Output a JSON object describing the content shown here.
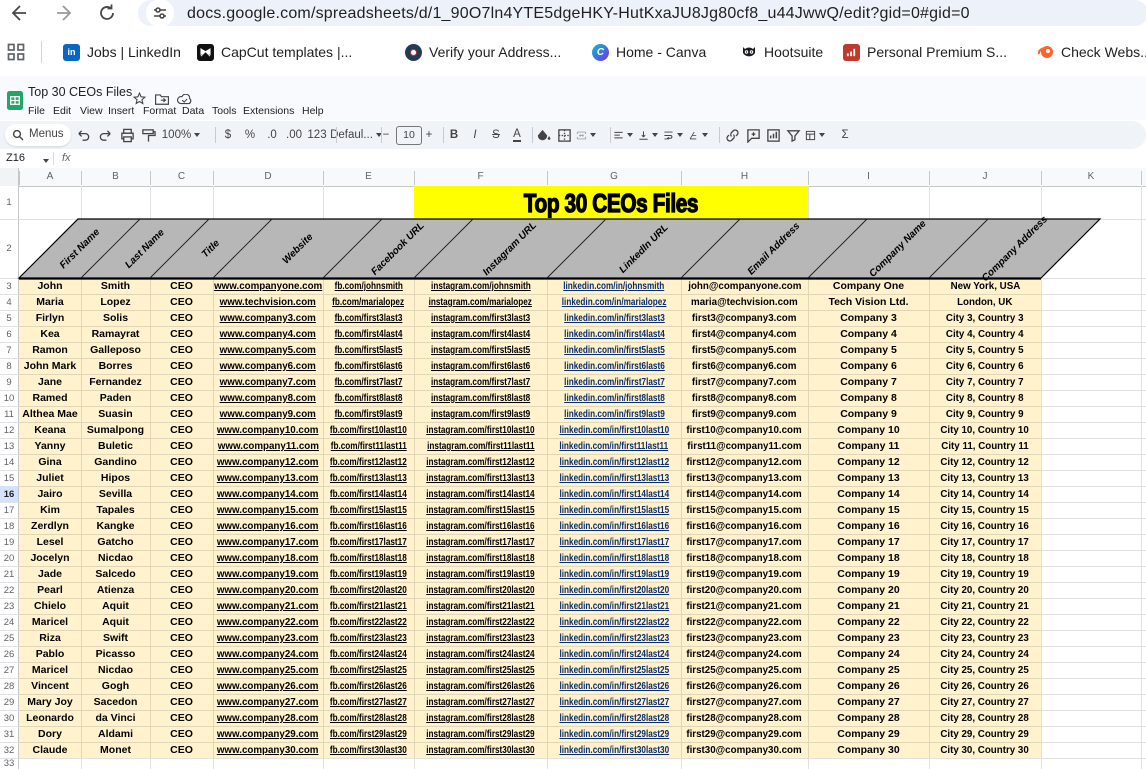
{
  "browser": {
    "url": "docs.google.com/spreadsheets/d/1_90O7ln4YTE5dgeHKY-HutKxaJU8Jg80cf8_u44JwwQ/edit?gid=0#gid=0",
    "bookmarks": [
      {
        "id": "linkedin",
        "label": "Jobs | LinkedIn"
      },
      {
        "id": "capcut",
        "label": "CapCut templates |..."
      },
      {
        "id": "verify",
        "label": "Verify your Address..."
      },
      {
        "id": "canva",
        "label": "Home - Canva"
      },
      {
        "id": "hootsuite",
        "label": "Hootsuite"
      },
      {
        "id": "premium",
        "label": "Personal Premium S..."
      },
      {
        "id": "checkwebs",
        "label": "Check Webs..."
      }
    ]
  },
  "appbar": {
    "title": "Top 30 CEOs Files",
    "menus": [
      "File",
      "Edit",
      "View",
      "Insert",
      "Format",
      "Data",
      "Tools",
      "Extensions",
      "Help"
    ]
  },
  "toolbar": {
    "menus_label": "Menus",
    "zoom": "100%",
    "currency": "$",
    "percent": "%",
    "decrease_decimals": ".0",
    "increase_decimals": ".00",
    "more_formats": "123",
    "font_name": "Defaul...",
    "font_size": "10",
    "bold": "B",
    "italic": "I",
    "strikethrough": "S",
    "text_color": "A",
    "functions": "Σ"
  },
  "formula_bar": {
    "name_box": "Z16",
    "fx": "fx"
  },
  "sheet": {
    "col_letters": [
      "A",
      "B",
      "C",
      "D",
      "E",
      "F",
      "G",
      "H",
      "I",
      "J",
      "K"
    ],
    "banner_title": "Top 30 CEOs Files",
    "headers": [
      "First Name",
      "Last Name",
      "Title",
      "Website",
      "Facebook URL",
      "Instagram URL",
      "LinkedIn URL",
      "Email Address",
      "Company Name",
      "Company Address"
    ],
    "selected_row": 16,
    "first_data_row": 3,
    "rows": [
      [
        "John",
        "Smith",
        "CEO",
        "www.companyone.com",
        "fb.com/johnsmith",
        "instagram.com/johnsmith",
        "linkedin.com/in/johnsmith",
        "john@companyone.com",
        "Company One",
        "New York, USA"
      ],
      [
        "Maria",
        "Lopez",
        "CEO",
        "www.techvision.com",
        "fb.com/marialopez",
        "instagram.com/marialopez",
        "linkedin.com/in/marialopez",
        "maria@techvision.com",
        "Tech Vision Ltd.",
        "London, UK"
      ],
      [
        "Firlyn",
        "Solis",
        "CEO",
        "www.company3.com",
        "fb.com/first3last3",
        "instagram.com/first3last3",
        "linkedin.com/in/first3last3",
        "first3@company3.com",
        "Company 3",
        "City 3, Country 3"
      ],
      [
        "Kea",
        "Ramayrat",
        "CEO",
        "www.company4.com",
        "fb.com/first4last4",
        "instagram.com/first4last4",
        "linkedin.com/in/first4last4",
        "first4@company4.com",
        "Company 4",
        "City 4, Country 4"
      ],
      [
        "Ramon",
        "Galleposo",
        "CEO",
        "www.company5.com",
        "fb.com/first5last5",
        "instagram.com/first5last5",
        "linkedin.com/in/first5last5",
        "first5@company5.com",
        "Company 5",
        "City 5, Country 5"
      ],
      [
        "John Mark",
        "Borres",
        "CEO",
        "www.company6.com",
        "fb.com/first6last6",
        "instagram.com/first6last6",
        "linkedin.com/in/first6last6",
        "first6@company6.com",
        "Company 6",
        "City 6, Country 6"
      ],
      [
        "Jane",
        "Fernandez",
        "CEO",
        "www.company7.com",
        "fb.com/first7last7",
        "instagram.com/first7last7",
        "linkedin.com/in/first7last7",
        "first7@company7.com",
        "Company 7",
        "City 7, Country 7"
      ],
      [
        "Ramed",
        "Paden",
        "CEO",
        "www.company8.com",
        "fb.com/first8last8",
        "instagram.com/first8last8",
        "linkedin.com/in/first8last8",
        "first8@company8.com",
        "Company 8",
        "City 8, Country 8"
      ],
      [
        "Althea Mae",
        "Suasin",
        "CEO",
        "www.company9.com",
        "fb.com/first9last9",
        "instagram.com/first9last9",
        "linkedin.com/in/first9last9",
        "first9@company9.com",
        "Company 9",
        "City 9, Country 9"
      ],
      [
        "Keana",
        "Sumalpong",
        "CEO",
        "www.company10.com",
        "fb.com/first10last10",
        "instagram.com/first10last10",
        "linkedin.com/in/first10last10",
        "first10@company10.com",
        "Company 10",
        "City 10, Country 10"
      ],
      [
        "Yanny",
        "Buletic",
        "CEO",
        "www.company11.com",
        "fb.com/first11last11",
        "instagram.com/first11last11",
        "linkedin.com/in/first11last11",
        "first11@company11.com",
        "Company 11",
        "City 11, Country 11"
      ],
      [
        "Gina",
        "Gandino",
        "CEO",
        "www.company12.com",
        "fb.com/first12last12",
        "instagram.com/first12last12",
        "linkedin.com/in/first12last12",
        "first12@company12.com",
        "Company 12",
        "City 12, Country 12"
      ],
      [
        "Juliet",
        "Hipos",
        "CEO",
        "www.company13.com",
        "fb.com/first13last13",
        "instagram.com/first13last13",
        "linkedin.com/in/first13last13",
        "first13@company13.com",
        "Company 13",
        "City 13, Country 13"
      ],
      [
        "Jairo",
        "Sevilla",
        "CEO",
        "www.company14.com",
        "fb.com/first14last14",
        "instagram.com/first14last14",
        "linkedin.com/in/first14last14",
        "first14@company14.com",
        "Company 14",
        "City 14, Country 14"
      ],
      [
        "Kim",
        "Tapales",
        "CEO",
        "www.company15.com",
        "fb.com/first15last15",
        "instagram.com/first15last15",
        "linkedin.com/in/first15last15",
        "first15@company15.com",
        "Company 15",
        "City 15, Country 15"
      ],
      [
        "Zerdlyn",
        "Kangke",
        "CEO",
        "www.company16.com",
        "fb.com/first16last16",
        "instagram.com/first16last16",
        "linkedin.com/in/first16last16",
        "first16@company16.com",
        "Company 16",
        "City 16, Country 16"
      ],
      [
        "Lesel",
        "Gatcho",
        "CEO",
        "www.company17.com",
        "fb.com/first17last17",
        "instagram.com/first17last17",
        "linkedin.com/in/first17last17",
        "first17@company17.com",
        "Company 17",
        "City 17, Country 17"
      ],
      [
        "Jocelyn",
        "Nicdao",
        "CEO",
        "www.company18.com",
        "fb.com/first18last18",
        "instagram.com/first18last18",
        "linkedin.com/in/first18last18",
        "first18@company18.com",
        "Company 18",
        "City 18, Country 18"
      ],
      [
        "Jade",
        "Salcedo",
        "CEO",
        "www.company19.com",
        "fb.com/first19last19",
        "instagram.com/first19last19",
        "linkedin.com/in/first19last19",
        "first19@company19.com",
        "Company 19",
        "City 19, Country 19"
      ],
      [
        "Pearl",
        "Atienza",
        "CEO",
        "www.company20.com",
        "fb.com/first20last20",
        "instagram.com/first20last20",
        "linkedin.com/in/first20last20",
        "first20@company20.com",
        "Company 20",
        "City 20, Country 20"
      ],
      [
        "Chielo",
        "Aquit",
        "CEO",
        "www.company21.com",
        "fb.com/first21last21",
        "instagram.com/first21last21",
        "linkedin.com/in/first21last21",
        "first21@company21.com",
        "Company 21",
        "City 21, Country 21"
      ],
      [
        "Maricel",
        "Aquit",
        "CEO",
        "www.company22.com",
        "fb.com/first22last22",
        "instagram.com/first22last22",
        "linkedin.com/in/first22last22",
        "first22@company22.com",
        "Company 22",
        "City 22, Country 22"
      ],
      [
        "Riza",
        "Swift",
        "CEO",
        "www.company23.com",
        "fb.com/first23last23",
        "instagram.com/first23last23",
        "linkedin.com/in/first23last23",
        "first23@company23.com",
        "Company 23",
        "City 23, Country 23"
      ],
      [
        "Pablo",
        "Picasso",
        "CEO",
        "www.company24.com",
        "fb.com/first24last24",
        "instagram.com/first24last24",
        "linkedin.com/in/first24last24",
        "first24@company24.com",
        "Company 24",
        "City 24, Country 24"
      ],
      [
        "Maricel",
        "Nicdao",
        "CEO",
        "www.company25.com",
        "fb.com/first25last25",
        "instagram.com/first25last25",
        "linkedin.com/in/first25last25",
        "first25@company25.com",
        "Company 25",
        "City 25, Country 25"
      ],
      [
        "Vincent",
        "Gogh",
        "CEO",
        "www.company26.com",
        "fb.com/first26last26",
        "instagram.com/first26last26",
        "linkedin.com/in/first26last26",
        "first26@company26.com",
        "Company 26",
        "City 26, Country 26"
      ],
      [
        "Mary Joy",
        "Sacedon",
        "CEO",
        "www.company27.com",
        "fb.com/first27last27",
        "instagram.com/first27last27",
        "linkedin.com/in/first27last27",
        "first27@company27.com",
        "Company 27",
        "City 27, Country 27"
      ],
      [
        "Leonardo",
        "da Vinci",
        "CEO",
        "www.company28.com",
        "fb.com/first28last28",
        "instagram.com/first28last28",
        "linkedin.com/in/first28last28",
        "first28@company28.com",
        "Company 28",
        "City 28, Country 28"
      ],
      [
        "Dory",
        "Aldami",
        "CEO",
        "www.company29.com",
        "fb.com/first29last29",
        "instagram.com/first29last29",
        "linkedin.com/in/first29last29",
        "first29@company29.com",
        "Company 29",
        "City 29, Country 29"
      ],
      [
        "Claude",
        "Monet",
        "CEO",
        "www.company30.com",
        "fb.com/first30last30",
        "instagram.com/first30last30",
        "linkedin.com/in/first30last30",
        "first30@company30.com",
        "Company 30",
        "City 30, Country 30"
      ]
    ]
  }
}
